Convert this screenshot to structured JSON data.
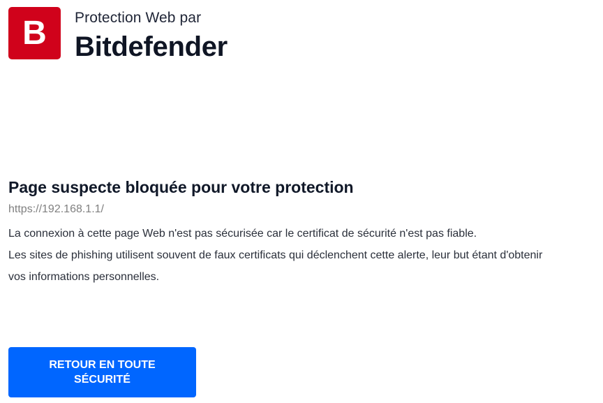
{
  "brand": {
    "logo_icon": "bitdefender-b-logo",
    "logo_letter": "B",
    "subtitle": "Protection Web par",
    "name": "Bitdefender"
  },
  "alert": {
    "title": "Page suspecte bloquée pour votre protection",
    "url": "https://192.168.1.1/",
    "description_lines": [
      "La connexion à cette page Web n'est pas sécurisée car le certificat de sécurité n'est pas fiable.",
      "Les sites de phishing utilisent souvent de faux certificats qui déclenchent cette alerte, leur but étant d'obtenir",
      "vos informations personnelles."
    ]
  },
  "actions": {
    "back_safely_label": "RETOUR EN TOUTE SÉCURITÉ"
  },
  "colors": {
    "brand_red": "#d0021b",
    "button_blue": "#0066ff",
    "text_dark": "#101828",
    "url_gray": "#808080"
  }
}
